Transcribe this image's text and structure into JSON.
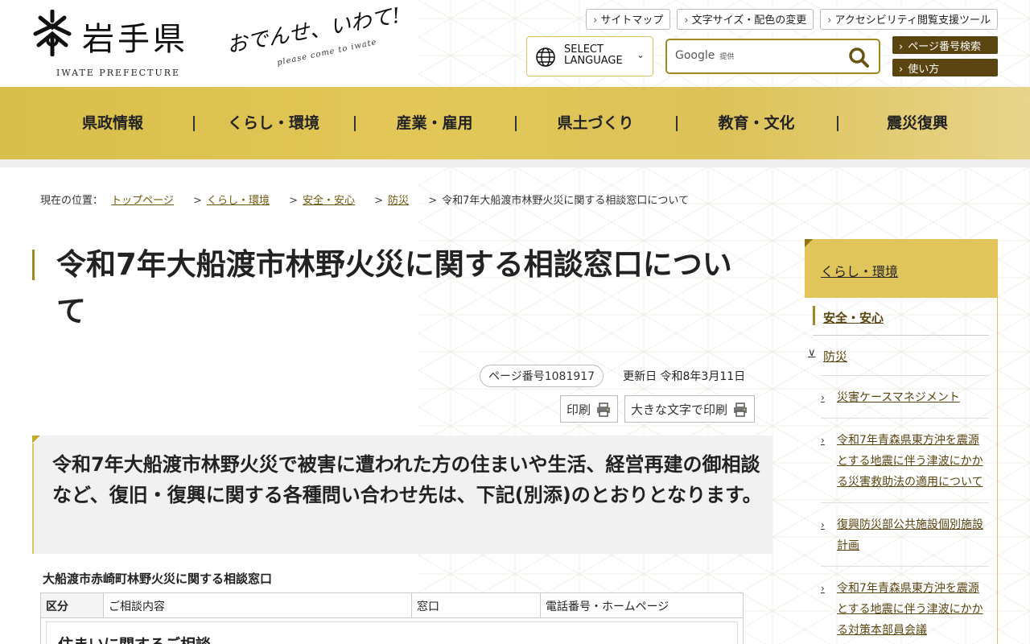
{
  "header": {
    "logo_text": "岩手県",
    "logo_en": "IWATE PREFECTURE",
    "slogan": "おでんせ、いわて!",
    "slogan_sub": "please come to iwate",
    "top_links": [
      "サイトマップ",
      "文字サイズ・配色の変更",
      "アクセシビリティ閲覧支援ツール"
    ],
    "language": {
      "line1": "SELECT",
      "line2": "LANGUAGE"
    },
    "search": {
      "brand": "Google",
      "provided": "提供"
    },
    "page_buttons": [
      "ページ番号検索",
      "使い方"
    ]
  },
  "nav": {
    "items": [
      "県政情報",
      "くらし・環境",
      "産業・雇用",
      "県土づくり",
      "教育・文化",
      "震災復興"
    ]
  },
  "breadcrumb": {
    "label": "現在の位置：",
    "links": [
      "トップページ",
      "くらし・環境",
      "安全・安心",
      "防災"
    ],
    "current": "令和7年大船渡市林野火災に関する相談窓口について"
  },
  "main": {
    "title": "令和7年大船渡市林野火災に関する相談窓口について",
    "page_number": "ページ番号1081917",
    "updated": "更新日 令和8年3月11日",
    "print_buttons": [
      "印刷",
      "大きな文字で印刷"
    ],
    "lead": "令和7年大船渡市林野火災で被害に遭われた方の住まいや生活、経営再建の御相談など、復旧・復興に関する各種問い合わせ先は、下記(別添)のとおりとなります。",
    "table_caption": "大船渡市赤崎町林野火災に関する相談窓口",
    "table_headers": [
      "区分",
      "ご相談内容",
      "窓口",
      "電話番号・ホームページ"
    ],
    "table_first_section": "住まいに関するご相談"
  },
  "sidebar": {
    "heading": "くらし・環境",
    "level1": "安全・安心",
    "level2": "防災",
    "items": [
      "災害ケースマネジメント",
      "令和7年青森県東方沖を震源とする地震に伴う津波にかかる災害救助法の適用について",
      "復興防災部公共施設個別施設計画",
      "令和7年青森県東方沖を震源とする地震に伴う津波にかかる対策本部員会議"
    ]
  },
  "colors": {
    "gold": "#e0c55b",
    "dark_brown": "#5a4511",
    "link": "#6e5708"
  }
}
